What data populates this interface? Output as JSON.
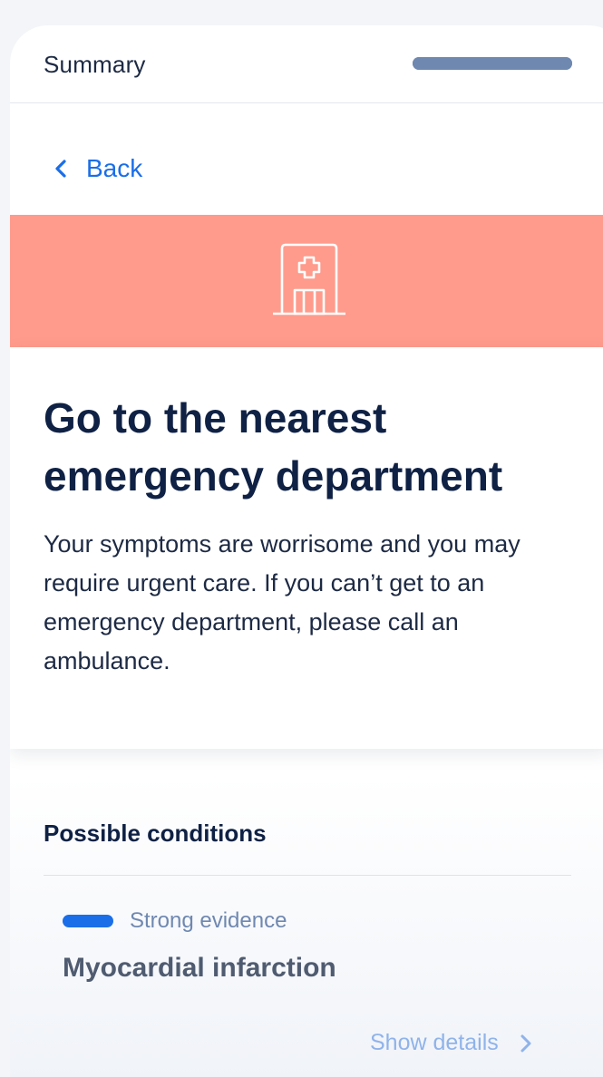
{
  "header": {
    "title": "Summary",
    "progress": 1.0,
    "progress_color": "#6f88b0"
  },
  "nav": {
    "back_label": "Back",
    "back_icon": "chevron-left-icon",
    "accent_color": "#1a6ee8"
  },
  "triage": {
    "banner_color": "#ff9b8c",
    "banner_icon": "hospital-icon",
    "headline": "Go to the nearest emergency department",
    "description": "Your symptoms are worrisome and you may require urgent care. If you can’t get to an emergency department, please call an ambulance."
  },
  "conditions": {
    "section_title": "Possible conditions",
    "items": [
      {
        "evidence_label": "Strong evidence",
        "name": "Myocardial infarction",
        "details_label": "Show details",
        "details_icon": "chevron-right-icon"
      }
    ]
  }
}
